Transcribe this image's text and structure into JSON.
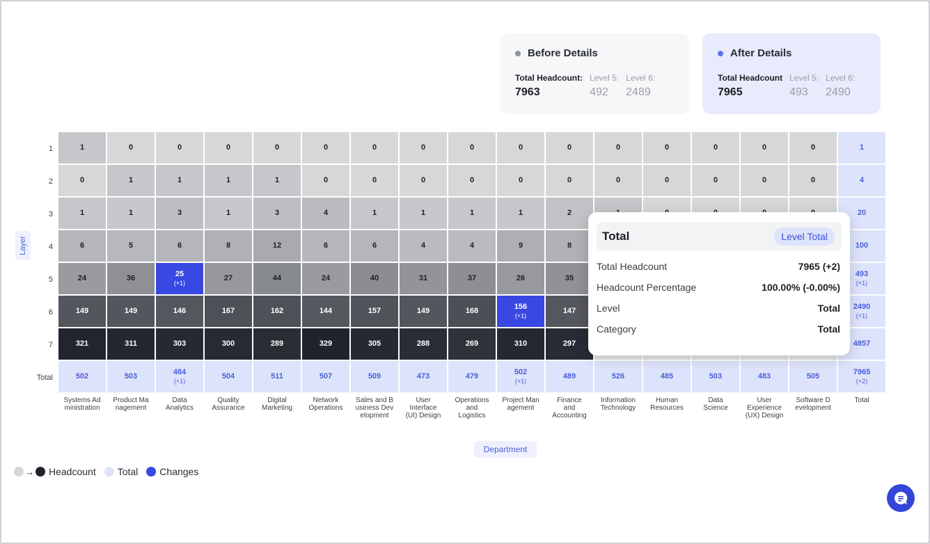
{
  "summary": {
    "before": {
      "title": "Before Details",
      "headcount_label": "Total Headcount:",
      "headcount": "7963",
      "level5_label": "Level 5:",
      "level5": "492",
      "level6_label": "Level 6:",
      "level6": "2489"
    },
    "after": {
      "title": "After Details",
      "headcount_label": "Total Headcount",
      "headcount": "7965",
      "level5_label": "Level 5:",
      "level5": "493",
      "level6_label": "Level 6:",
      "level6": "2490"
    }
  },
  "axis": {
    "y_label": "Layer",
    "x_label": "Department"
  },
  "legend": {
    "headcount": "Headcount",
    "total": "Total",
    "changes": "Changes"
  },
  "tooltip": {
    "title": "Total",
    "badge": "Level Total",
    "rows": [
      {
        "label": "Total Headcount",
        "value": "7965 (+2)"
      },
      {
        "label": "Headcount Percentage",
        "value": "100.00% (-0.00%)"
      },
      {
        "label": "Level",
        "value": "Total"
      },
      {
        "label": "Category",
        "value": "Total"
      }
    ]
  },
  "colors": {
    "accent": "#3848e2",
    "total_bg": "#dde3fb",
    "total_text": "#4a5fd6",
    "heat_low": "#d6d7d9",
    "heat_high": "#1f232b"
  },
  "chart_data": {
    "type": "heatmap",
    "rows": [
      "1",
      "2",
      "3",
      "4",
      "5",
      "6",
      "7",
      "Total"
    ],
    "columns": [
      "Systems Administration",
      "Product Management",
      "Data Analytics",
      "Quality Assurance",
      "Digital Marketing",
      "Network Operations",
      "Sales and Business Development",
      "User Interface (UI) Design",
      "Operations and Logistics",
      "Project Management",
      "Finance and Accounting",
      "Information Technology",
      "Human Resources",
      "Data Science",
      "User Experience (UX) Design",
      "Software Development",
      "Total"
    ],
    "column_labels": [
      [
        "Systems Ad",
        "ministration"
      ],
      [
        "Product Ma",
        "nagement"
      ],
      [
        "Data",
        "Analytics"
      ],
      [
        "Quality",
        "Assurance"
      ],
      [
        "Digital",
        "Marketing"
      ],
      [
        "Network",
        "Operations"
      ],
      [
        "Sales and B",
        "usiness Dev",
        "elopment"
      ],
      [
        "User",
        "Interface",
        "(UI) Design"
      ],
      [
        "Operations",
        "and",
        "Logistics"
      ],
      [
        "Project Man",
        "agement"
      ],
      [
        "Finance",
        "and",
        "Accounting"
      ],
      [
        "Information",
        "Technology"
      ],
      [
        "Human",
        "Resources"
      ],
      [
        "Data",
        "Science"
      ],
      [
        "User",
        "Experience",
        "(UX) Design"
      ],
      [
        "Software D",
        "evelopment"
      ],
      [
        "Total"
      ]
    ],
    "values": [
      [
        1,
        0,
        0,
        0,
        0,
        0,
        0,
        0,
        0,
        0,
        0,
        0,
        0,
        0,
        0,
        0,
        1
      ],
      [
        0,
        1,
        1,
        1,
        1,
        0,
        0,
        0,
        0,
        0,
        0,
        0,
        0,
        0,
        0,
        0,
        4
      ],
      [
        1,
        1,
        3,
        1,
        3,
        4,
        1,
        1,
        1,
        1,
        2,
        1,
        0,
        0,
        0,
        0,
        20
      ],
      [
        6,
        5,
        6,
        8,
        12,
        6,
        6,
        4,
        4,
        9,
        8,
        null,
        null,
        null,
        null,
        null,
        100
      ],
      [
        24,
        36,
        25,
        27,
        44,
        24,
        40,
        31,
        37,
        26,
        35,
        null,
        null,
        null,
        null,
        null,
        493
      ],
      [
        149,
        149,
        146,
        167,
        162,
        144,
        157,
        149,
        168,
        156,
        147,
        null,
        null,
        null,
        null,
        null,
        2490
      ],
      [
        321,
        311,
        303,
        300,
        289,
        329,
        305,
        288,
        269,
        310,
        297,
        null,
        null,
        null,
        null,
        null,
        4857
      ],
      [
        502,
        503,
        484,
        504,
        511,
        507,
        509,
        473,
        479,
        502,
        489,
        526,
        485,
        503,
        483,
        505,
        7965
      ]
    ],
    "changes": [
      {
        "row": 4,
        "col": 2,
        "label": "(+1)"
      },
      {
        "row": 5,
        "col": 9,
        "label": "(+1)"
      },
      {
        "row": 4,
        "col": 16,
        "label": "(+1)"
      },
      {
        "row": 5,
        "col": 16,
        "label": "(+1)"
      },
      {
        "row": 7,
        "col": 2,
        "label": "(+1)"
      },
      {
        "row": 7,
        "col": 9,
        "label": "(+1)"
      },
      {
        "row": 7,
        "col": 16,
        "label": "(+2)"
      }
    ],
    "changed_cells": [
      [
        4,
        2
      ],
      [
        5,
        9
      ]
    ],
    "xlabel": "Department",
    "ylabel": "Layer"
  }
}
